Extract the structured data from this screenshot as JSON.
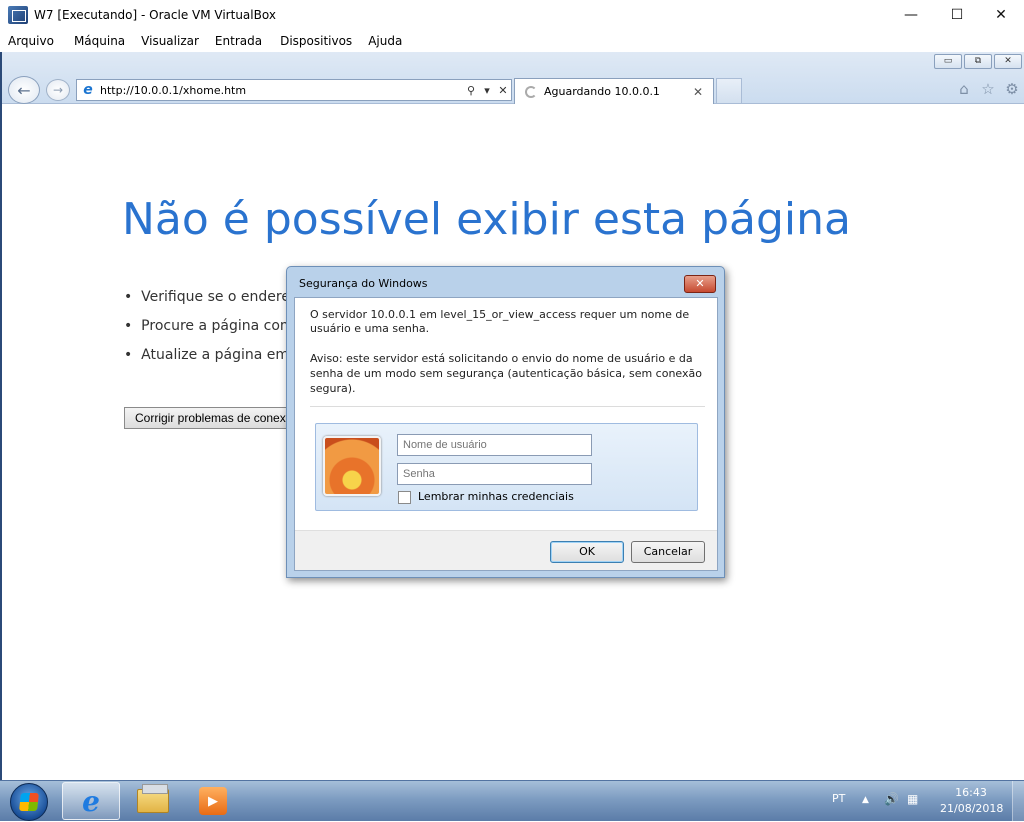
{
  "host": {
    "title": "W7 [Executando] - Oracle VM VirtualBox",
    "controls": {
      "minimize": "—",
      "maximize": "☐",
      "close": "✕"
    },
    "menu": [
      "Arquivo",
      "Máquina",
      "Visualizar",
      "Entrada",
      "Dispositivos",
      "Ajuda"
    ]
  },
  "browser": {
    "url": "http://10.0.0.1/xhome.htm",
    "tab_label": "Aguardando 10.0.0.1",
    "address_controls": {
      "search": "⚲",
      "dropdown": "▾",
      "stop": "✕"
    },
    "tab_close": "✕",
    "window_buttons": [
      "▭",
      "⧉",
      "✕"
    ],
    "nav": {
      "back": "←",
      "forward": "→"
    },
    "tools": {
      "home": "⌂",
      "favorites": "☆",
      "settings": "⚙"
    }
  },
  "error_page": {
    "title": "Não é possível exibir esta página",
    "bullets": [
      "Verifique se o endereç",
      "Procure a página com",
      "Atualize a página em p"
    ],
    "fix_button": "Corrigir problemas de conexão"
  },
  "dialog": {
    "title": "Segurança do Windows",
    "close": "✕",
    "message": "O servidor 10.0.0.1 em level_15_or_view_access requer um nome de usuário e uma senha.",
    "warning": "Aviso: este servidor está solicitando o envio do nome de usuário e da senha de um modo sem segurança (autenticação básica, sem conexão segura).",
    "username_placeholder": "Nome de usuário",
    "password_placeholder": "Senha",
    "remember_label": "Lembrar minhas credenciais",
    "ok_label": "OK",
    "cancel_label": "Cancelar"
  },
  "taskbar": {
    "language": "PT",
    "tray_up": "▲",
    "speaker": "🔊",
    "network": "▦",
    "time": "16:43",
    "date": "21/08/2018",
    "ie_glyph": "e",
    "media_glyph": "▶"
  }
}
